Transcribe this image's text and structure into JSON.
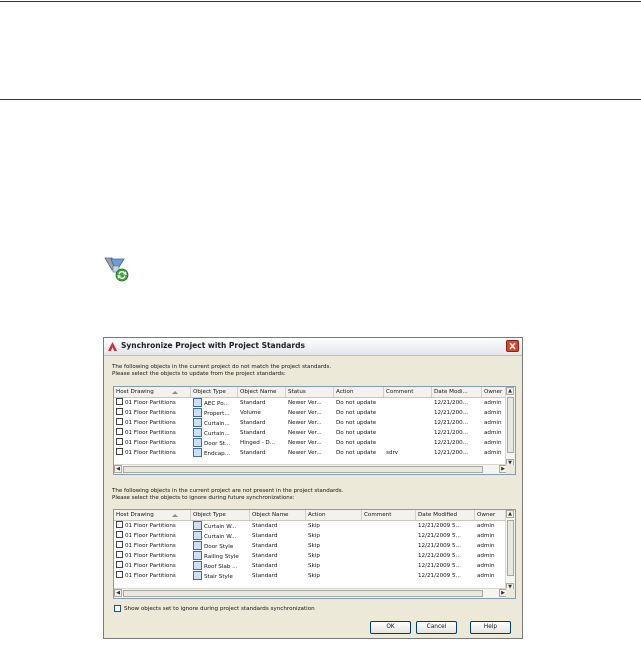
{
  "dialog": {
    "title": "Synchronize Project with Project Standards",
    "section1_intro": [
      "The following objects in the current project do not match the project standards.",
      "Please select the objects to update from the project standards:"
    ],
    "section2_intro": [
      "The following objects in the current project are not present in the project standards.",
      "Please select the objects to ignore during future synchronizations:"
    ],
    "table1": {
      "columns": [
        "Host Drawing",
        "Object Type",
        "Object Name",
        "Status",
        "Action",
        "Comment",
        "Date Modi...",
        "Owner"
      ],
      "rows": [
        [
          "01 Floor Partitions",
          "AEC Po...",
          "Standard",
          "Newer Ver...",
          "Do not update",
          "",
          "12/21/200...",
          "admin"
        ],
        [
          "01 Floor Partitions",
          "Propert...",
          "Volume",
          "Newer Ver...",
          "Do not update",
          "",
          "12/21/200...",
          "admin"
        ],
        [
          "01 Floor Partitions",
          "Curtain...",
          "Standard",
          "Newer Ver...",
          "Do not update",
          "",
          "12/21/200...",
          "admin"
        ],
        [
          "01 Floor Partitions",
          "Curtain...",
          "Standard",
          "Newer Ver...",
          "Do not update",
          "",
          "12/21/200...",
          "admin"
        ],
        [
          "01 Floor Partitions",
          "Door St...",
          "Hinged - D...",
          "Newer Ver...",
          "Do not update",
          "",
          "12/21/200...",
          "admin"
        ],
        [
          "01 Floor Partitions",
          "Endcap...",
          "Standard",
          "Newer Ver...",
          "Do not update",
          "sdrv",
          "12/21/200...",
          "admin"
        ]
      ]
    },
    "table2": {
      "columns": [
        "Host Drawing",
        "Object Type",
        "Object Name",
        "Action",
        "Comment",
        "Date Modified",
        "Owner"
      ],
      "rows": [
        [
          "01 Floor Partitions",
          "Curtain W...",
          "Standard",
          "Skip",
          "",
          "12/21/2009 5...",
          "admin"
        ],
        [
          "01 Floor Partitions",
          "Curtain W...",
          "Standard",
          "Skip",
          "",
          "12/21/2009 5...",
          "admin"
        ],
        [
          "01 Floor Partitions",
          "Door Style",
          "Standard",
          "Skip",
          "",
          "12/21/2009 5...",
          "admin"
        ],
        [
          "01 Floor Partitions",
          "Railing Style",
          "Standard",
          "Skip",
          "",
          "12/21/2009 5...",
          "admin"
        ],
        [
          "01 Floor Partitions",
          "Roof Slab ...",
          "Standard",
          "Skip",
          "",
          "12/21/2009 5...",
          "admin"
        ],
        [
          "01 Floor Partitions",
          "Stair Style",
          "Standard",
          "Skip",
          "",
          "12/21/2009 5...",
          "admin"
        ]
      ]
    },
    "checkbox_label": "Show objects set to ignore during project standards synchronization",
    "checkbox_checked": false,
    "buttons": {
      "ok": "OK",
      "cancel": "Cancel",
      "help": "Help"
    }
  }
}
